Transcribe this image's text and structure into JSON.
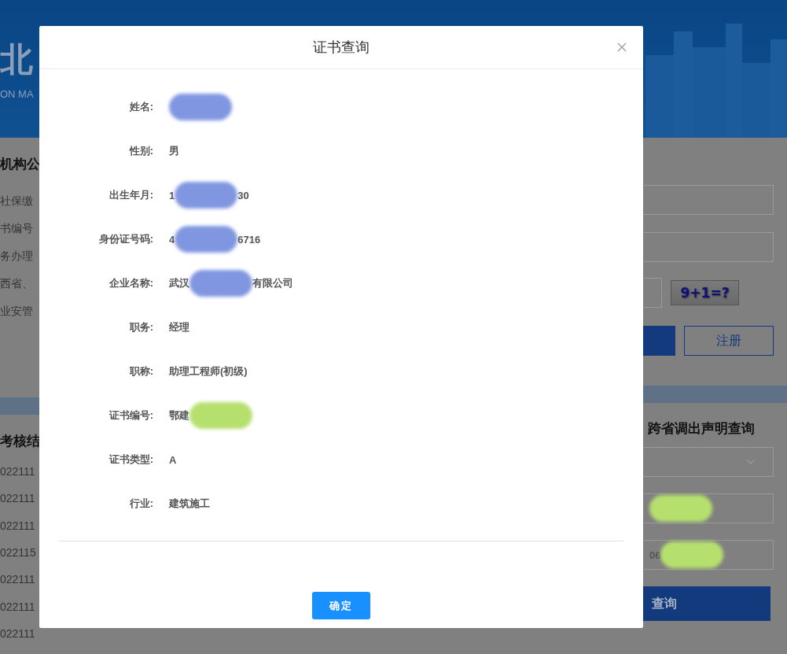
{
  "background": {
    "header": {
      "title_fragment": "北",
      "subtitle_fragment": "ON MA"
    },
    "left_panel": {
      "heading": "机构公",
      "notices": [
        "社保缴",
        "书编号",
        "务办理",
        "西省、",
        "业安管"
      ],
      "section_heading": "考核结",
      "rows": [
        "022111",
        "022111",
        "022111",
        "022115",
        "022111",
        "022111",
        "022111"
      ]
    },
    "right_panel": {
      "captcha": "9+1=?",
      "register_button": "注册",
      "section_heading": "跨省调出声明查询",
      "query_fields": [
        {
          "value_parts": [
            {
              "kind": "redacted",
              "color": "#b5e06e"
            }
          ]
        },
        {
          "value_parts": [
            {
              "kind": "text",
              "text": "06"
            },
            {
              "kind": "redacted",
              "color": "#b5e06e"
            }
          ]
        }
      ],
      "query_button": "查询"
    }
  },
  "dialog": {
    "title": "证书查询",
    "fields": [
      {
        "label": "姓名:",
        "value_parts": [
          {
            "kind": "redacted",
            "color": "#8096e0"
          }
        ]
      },
      {
        "label": "性别:",
        "value_parts": [
          {
            "kind": "text",
            "text": "男"
          }
        ]
      },
      {
        "label": "出生年月:",
        "value_parts": [
          {
            "kind": "text",
            "text": "1"
          },
          {
            "kind": "redacted",
            "color": "#8096e0"
          },
          {
            "kind": "text",
            "text": "30"
          }
        ]
      },
      {
        "label": "身份证号码:",
        "value_parts": [
          {
            "kind": "text",
            "text": "4"
          },
          {
            "kind": "redacted",
            "color": "#8096e0"
          },
          {
            "kind": "text",
            "text": "6716"
          }
        ]
      },
      {
        "label": "企业名称:",
        "value_parts": [
          {
            "kind": "text",
            "text": "武汉"
          },
          {
            "kind": "redacted",
            "color": "#8096e0"
          },
          {
            "kind": "text",
            "text": "有限公司"
          }
        ]
      },
      {
        "label": "职务:",
        "value_parts": [
          {
            "kind": "text",
            "text": "经理"
          }
        ]
      },
      {
        "label": "职称:",
        "value_parts": [
          {
            "kind": "text",
            "text": "助理工程师(初级)"
          }
        ]
      },
      {
        "label": "证书编号:",
        "value_parts": [
          {
            "kind": "text",
            "text": "鄂建"
          },
          {
            "kind": "redacted",
            "color": "#b5e06e"
          }
        ]
      },
      {
        "label": "证书类型:",
        "value_parts": [
          {
            "kind": "text",
            "text": "A"
          }
        ]
      },
      {
        "label": "行业:",
        "value_parts": [
          {
            "kind": "text",
            "text": "建筑施工"
          }
        ]
      }
    ],
    "ok_button": "确定"
  }
}
